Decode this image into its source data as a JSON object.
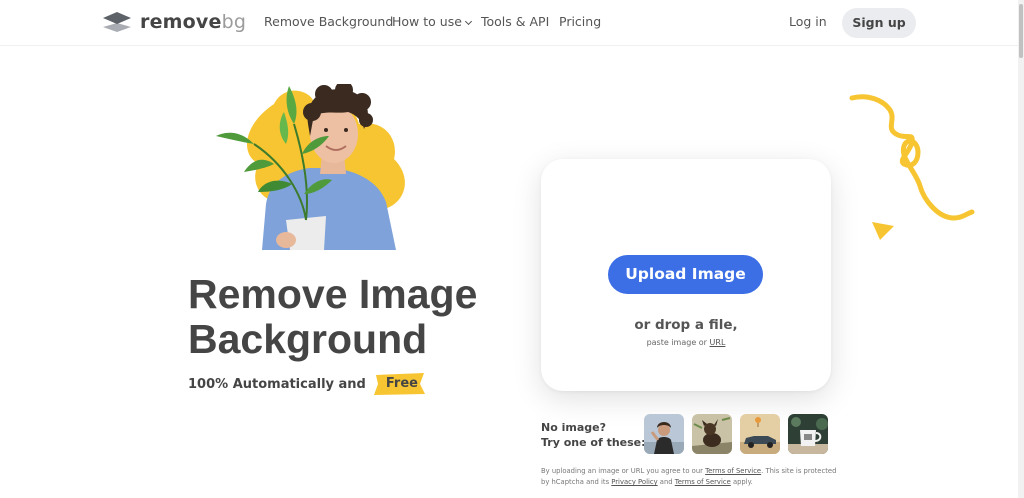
{
  "header": {
    "logo": {
      "text_main": "remove",
      "text_accent": "bg",
      "icon": "layers-logo-icon"
    },
    "nav": [
      {
        "label": "Remove Background"
      },
      {
        "label": "How to use",
        "has_dropdown": true
      },
      {
        "label": "Tools & API"
      },
      {
        "label": "Pricing"
      }
    ],
    "login_label": "Log in",
    "signup_label": "Sign up"
  },
  "hero": {
    "title_line1": "Remove Image",
    "title_line2": "Background",
    "subtitle_prefix": "100% Automatically and",
    "subtitle_highlight": "Free",
    "image": "person-holding-plant-cutout"
  },
  "upload": {
    "button_label": "Upload Image",
    "drop_text": "or drop a file,",
    "paste_prefix": "paste image or",
    "paste_link": "URL"
  },
  "samples": {
    "prompt_line1": "No image?",
    "prompt_line2": "Try one of these:",
    "items": [
      "woman-portrait",
      "dog-on-rock",
      "vintage-car",
      "coffee-mug"
    ]
  },
  "legal": {
    "text1": "By uploading an image or URL you agree to our",
    "tos_link": "Terms of Service",
    "text2": ". This site is protected by hCaptcha and its",
    "privacy_link": "Privacy Policy",
    "text3": "and its",
    "tos_link2": "Terms of Service",
    "text4": "apply."
  },
  "colors": {
    "primary": "#3c6fe6",
    "accent_yellow": "#f7c531",
    "text": "#454545",
    "signup_bg": "#ebecef"
  }
}
